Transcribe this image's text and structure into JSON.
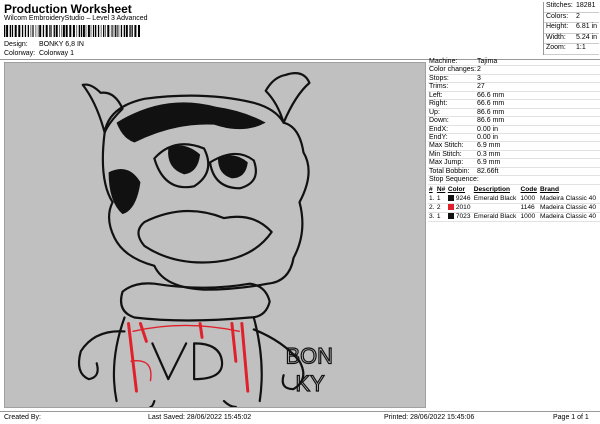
{
  "header": {
    "title": "Production Worksheet",
    "software": "Wilcom EmbroideryStudio – Level 3 Advanced",
    "barcode_text": "Production Worksheet barcode"
  },
  "design_info": [
    {
      "label": "Design:",
      "value": "BONKY 6,8 IN"
    },
    {
      "label": "Colorway:",
      "value": "Colorway 1"
    }
  ],
  "summary": [
    {
      "label": "Stitches:",
      "value": "18281"
    },
    {
      "label": "Colors:",
      "value": "2"
    },
    {
      "label": "Height:",
      "value": "6.81 in"
    },
    {
      "label": "Width:",
      "value": "5.24 in"
    },
    {
      "label": "Zoom:",
      "value": "1:1"
    }
  ],
  "machine_info": [
    {
      "label": "Machine:",
      "value": "Tajima"
    },
    {
      "label": "Color changes:",
      "value": "2"
    },
    {
      "label": "Stops:",
      "value": "3"
    },
    {
      "label": "Trims:",
      "value": "27"
    },
    {
      "label": "Left:",
      "value": "66.6 mm"
    },
    {
      "label": "Right:",
      "value": "66.6 mm"
    },
    {
      "label": "Up:",
      "value": "86.6 mm"
    },
    {
      "label": "Down:",
      "value": "86.6 mm"
    },
    {
      "label": "EndX:",
      "value": "0.00 in"
    },
    {
      "label": "EndY:",
      "value": "0.00 in"
    },
    {
      "label": "Max Stitch:",
      "value": "6.9 mm"
    },
    {
      "label": "Min Stitch:",
      "value": "0.3 mm"
    },
    {
      "label": "Max Jump:",
      "value": "6.9 mm"
    },
    {
      "label": "Total Bobbin:",
      "value": "82.66ft"
    }
  ],
  "stop_sequence": {
    "heading": "Stop Sequence:",
    "columns": [
      "#",
      "N#",
      "Color",
      "Description",
      "Code",
      "Brand"
    ],
    "rows": [
      {
        "num": "1.",
        "n": "1",
        "color": "#111111",
        "code_color": "9246",
        "description": "Emerald Black",
        "code": "1000",
        "brand": "Madeira Classic 40"
      },
      {
        "num": "2.",
        "n": "2",
        "color": "#e0202a",
        "code_color": "2010",
        "description": "",
        "code": "1146",
        "brand": "Madeira Classic 40"
      },
      {
        "num": "3.",
        "n": "1",
        "color": "#111111",
        "code_color": "7023",
        "description": "Emerald Black",
        "code": "1000",
        "brand": "Madeira Classic 40"
      }
    ]
  },
  "artwork": {
    "text_line1": "BON",
    "text_line2": "KY",
    "outline_color": "#111111",
    "accent_color": "#e0202a",
    "background_color": "#c0c0c0"
  },
  "footer": {
    "created_by": "Created By:",
    "last_saved": "Last Saved: 28/06/2022 15:45:02",
    "printed": "Printed: 28/06/2022 15:45:06",
    "page": "Page 1 of 1"
  }
}
